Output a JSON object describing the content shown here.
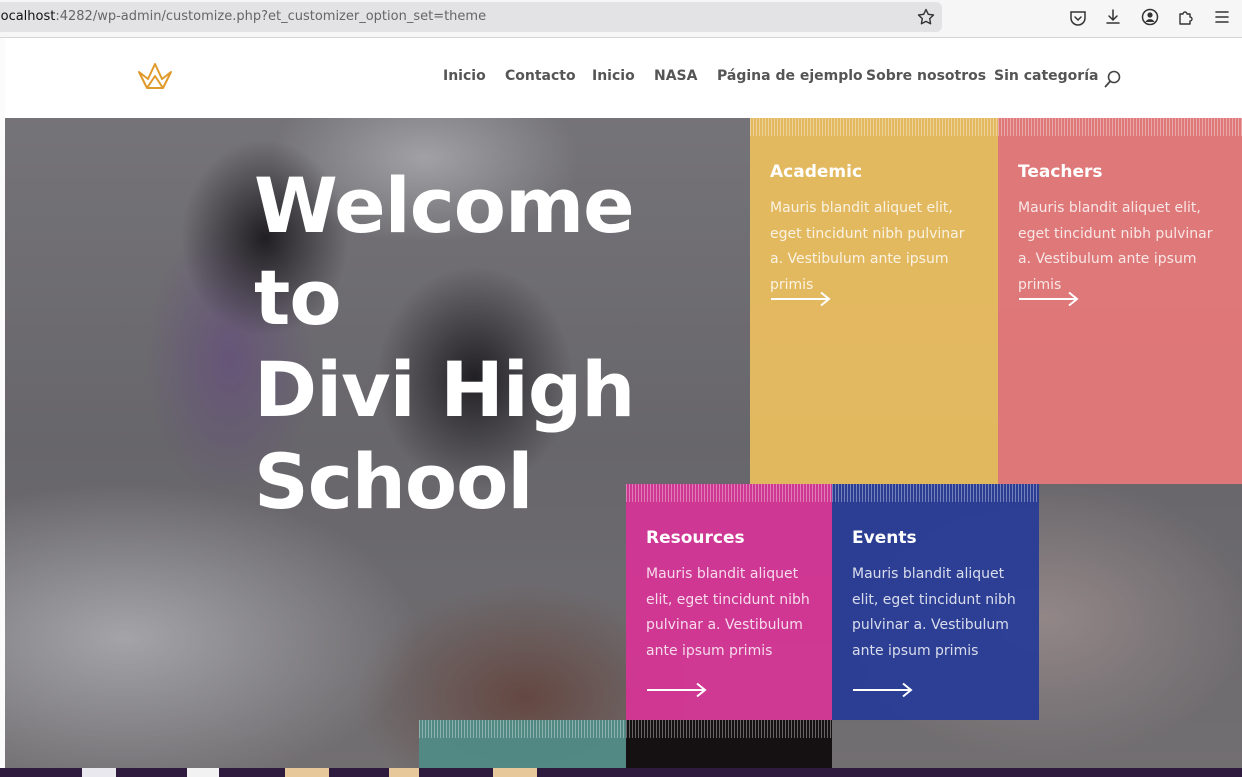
{
  "browser": {
    "url_host": "localhost",
    "url_rest": ":4282/wp-admin/customize.php?et_customizer_option_set=theme",
    "icons": [
      "star-icon",
      "pocket-icon",
      "download-icon",
      "account-icon",
      "extensions-icon",
      "menu-icon"
    ]
  },
  "site": {
    "logo": "crown-logo",
    "nav": [
      "Inicio",
      "Contacto",
      "Inicio",
      "NASA",
      "Página de ejemplo",
      "Sobre nosotros",
      "Sin categoría"
    ],
    "search_icon": "search-icon"
  },
  "hero": {
    "title_lines": [
      "Welcome to",
      "Divi High",
      "School"
    ]
  },
  "cards": {
    "academic": {
      "title": "Academic",
      "text": "Mauris blandit aliquet elit, eget tincidunt nibh pulvinar a. Vestibulum ante ipsum primis",
      "color": "#ecbe5f"
    },
    "teachers": {
      "title": "Teachers",
      "text": "Mauris blandit aliquet elit, eget tincidunt nibh pulvinar a. Vestibulum ante ipsum primis",
      "color": "#e77878"
    },
    "resources": {
      "title": "Resources",
      "text": "Mauris blandit aliquet elit, eget tincidunt nibh pulvinar a. Vestibulum ante ipsum primis",
      "color": "#d63496"
    },
    "events": {
      "title": "Events",
      "text": "Mauris blandit aliquet elit, eget tincidunt nibh pulvinar a. Vestibulum ante ipsum primis",
      "color": "#283c96"
    }
  },
  "colors": {
    "accent_logo": "#e09a2b",
    "nav_text": "#555555"
  }
}
